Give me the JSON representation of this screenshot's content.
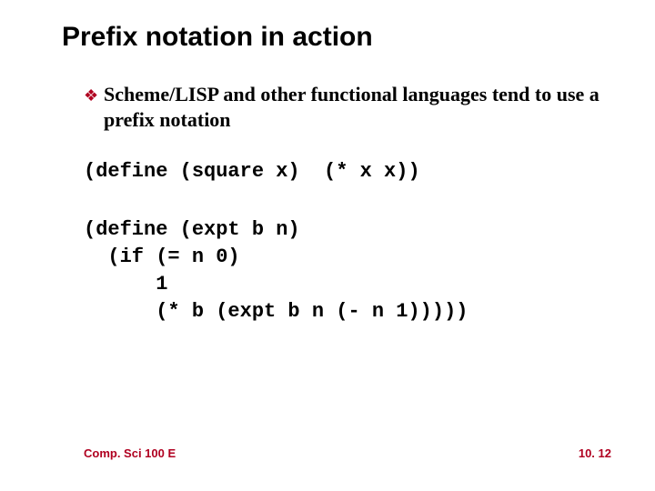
{
  "title": "Prefix notation in action",
  "bullet": {
    "glyph": "❖",
    "text": "Scheme/LISP and other functional languages tend to use a prefix notation"
  },
  "code1": "(define (square x)  (* x x))",
  "code2": "(define (expt b n)\n  (if (= n 0)\n      1\n      (* b (expt b n (- n 1)))))",
  "footer": {
    "left": "Comp. Sci 100 E",
    "right": "10. 12"
  }
}
